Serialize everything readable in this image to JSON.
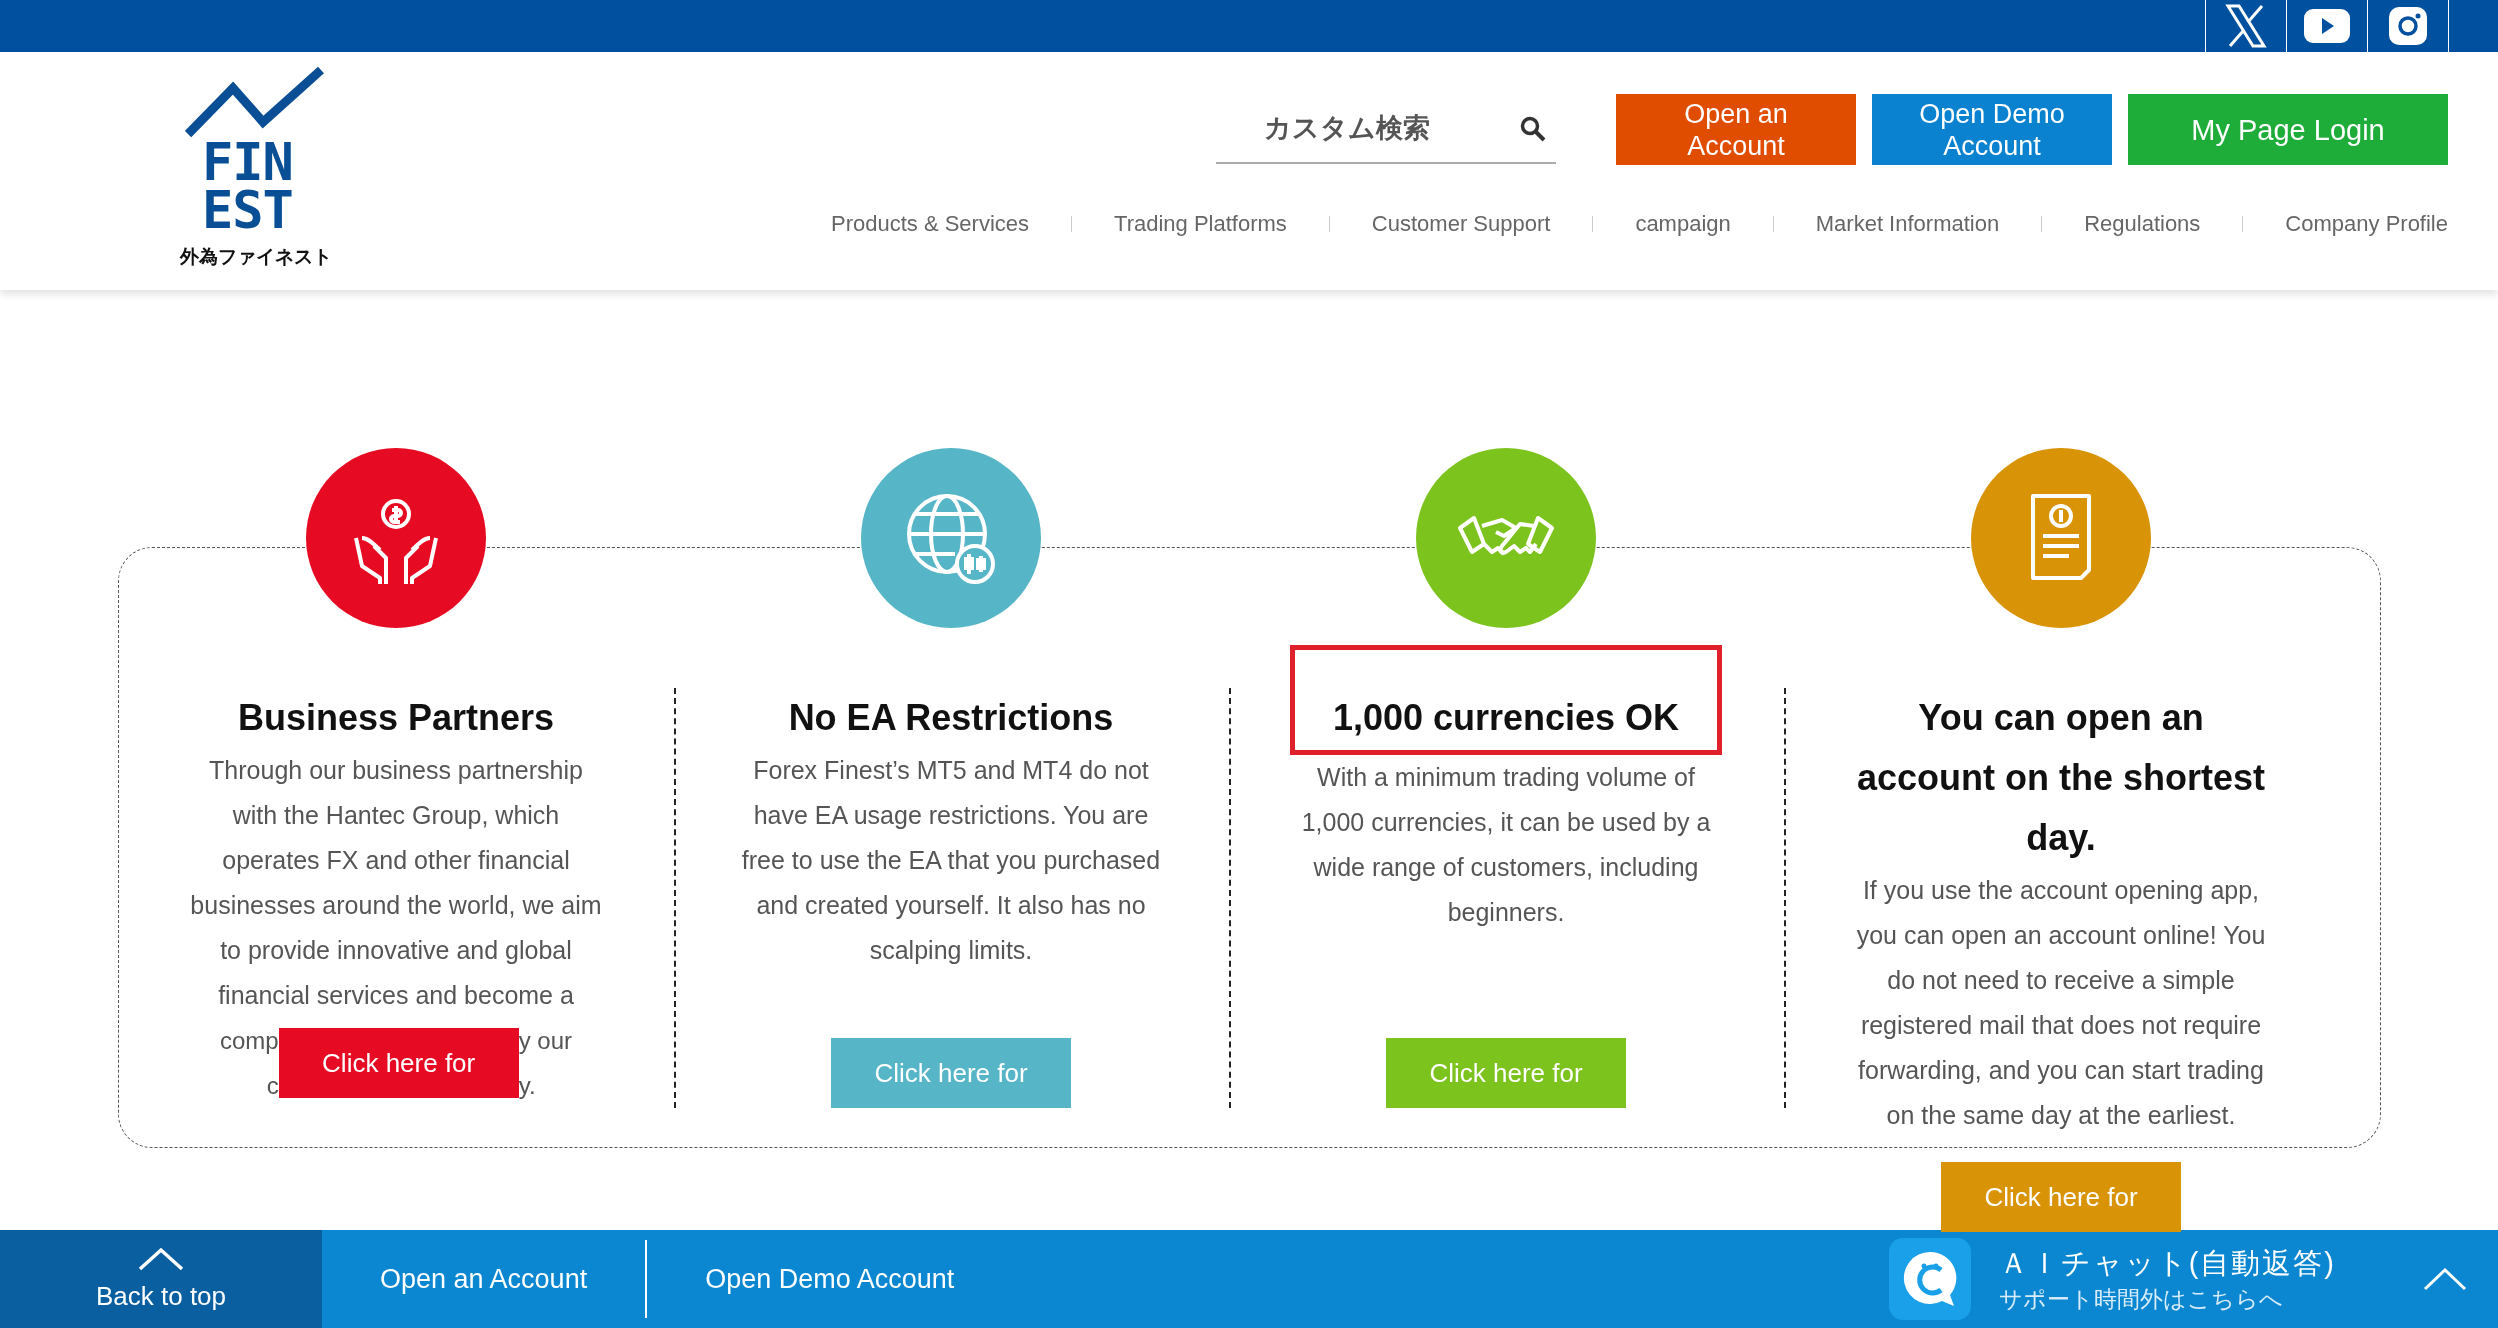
{
  "top_bar": {
    "social_links": [
      {
        "kind": "x"
      },
      {
        "kind": "youtube"
      },
      {
        "kind": "instagram"
      }
    ]
  },
  "header": {
    "logo": {
      "lines": [
        "FIN",
        "EST"
      ],
      "tagline": "外為ファイネスト"
    },
    "search": {
      "placeholder": "カスタム検索"
    },
    "buttons": [
      {
        "label": "Open an Account",
        "color": "#e04c00"
      },
      {
        "label": "Open Demo Account",
        "color": "#0a82d0"
      },
      {
        "label": "My Page Login",
        "color": "#1fad3a"
      }
    ],
    "nav": [
      "Products & Services",
      "Trading Platforms",
      "Customer Support",
      "campaign",
      "Market Information",
      "Regulations",
      "Company Profile"
    ]
  },
  "cards": [
    {
      "kind": "hands",
      "color": "#e60b22",
      "title": "Business Partners",
      "highlighted": false,
      "description": "Through our business partnership with the Hantec Group, which operates FX and other financial businesses around the world, we aim to provide innovative and global financial services and become a",
      "covered_lines": [
        {
          "left": "comp",
          "right": "y our"
        },
        {
          "left": "c",
          "right": "y."
        }
      ],
      "button": "Click here for"
    },
    {
      "kind": "globe",
      "color": "#56b5c6",
      "title": "No EA Restrictions",
      "highlighted": false,
      "description": "Forex Finest’s MT5 and MT4 do not have EA usage restrictions. You are free to use the EA that you purchased and created yourself. It also has no scalping limits.",
      "button": "Click here for"
    },
    {
      "kind": "handshake",
      "color": "#7dc31e",
      "title": "1,000 currencies OK",
      "highlighted": true,
      "description": "With a minimum trading volume of 1,000 currencies, it can be used by a wide range of customers, including beginners.",
      "button": "Click here for"
    },
    {
      "kind": "receipt",
      "color": "#d99306",
      "title": "You can open an account on the shortest day.",
      "highlighted": false,
      "description": "If you use the account opening app, you can open an account online! You do not need to receive a simple registered mail that does not require forwarding, and you can start trading on the same day at the earliest.",
      "button": "Click here for"
    }
  ],
  "bottom_bar": {
    "back_to_top": "Back to top",
    "links": [
      "Open an Account",
      "Open Demo Account"
    ],
    "chat": {
      "title": "ＡＩチャット(自動返答)",
      "subtitle": "サポート時間外はこちらへ"
    }
  }
}
